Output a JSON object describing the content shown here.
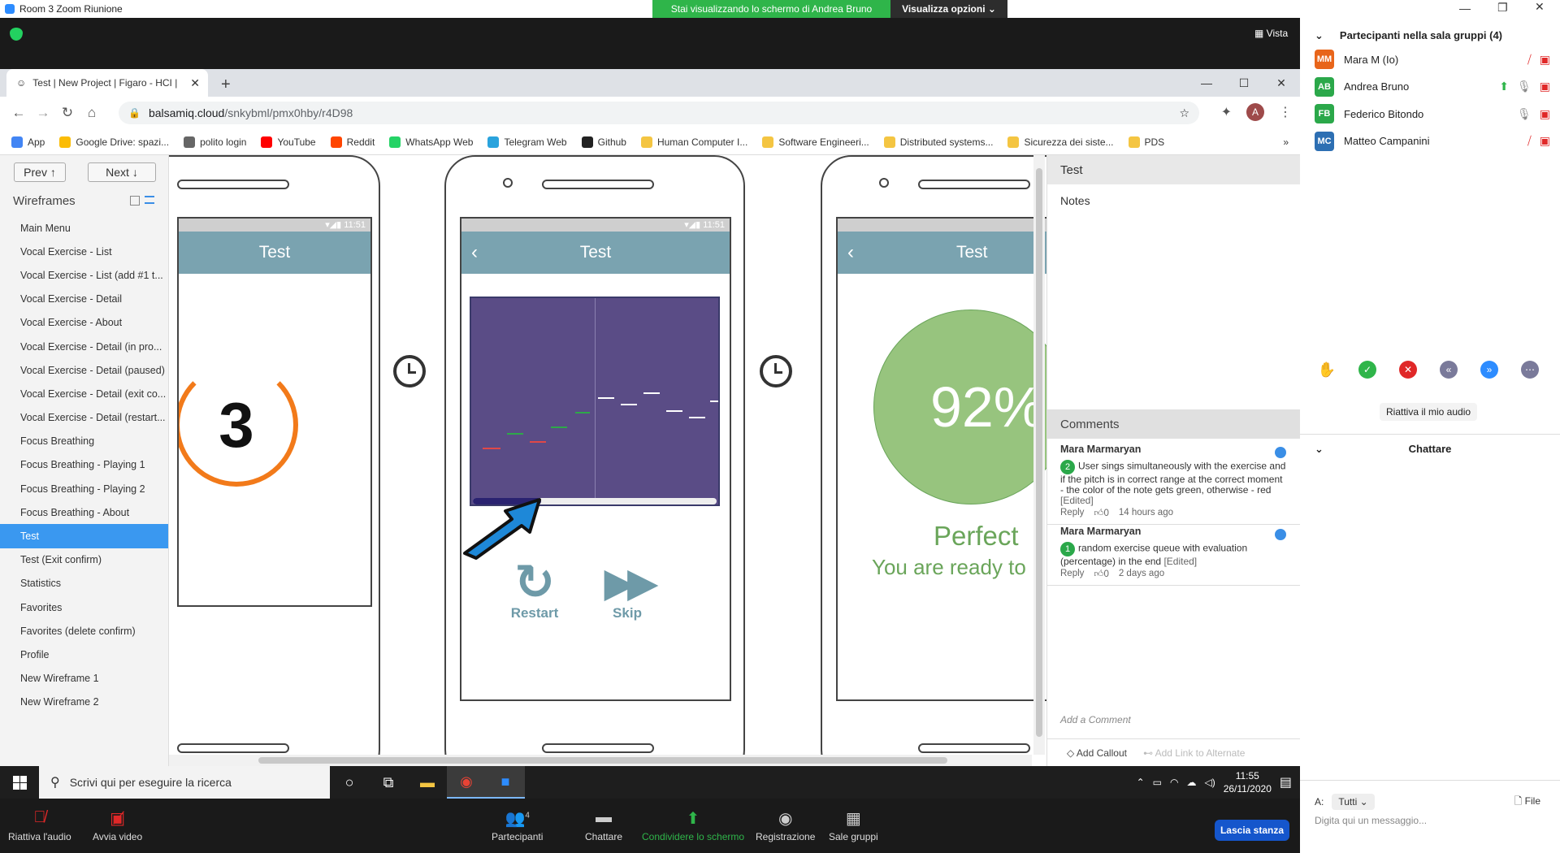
{
  "zoom": {
    "window_title": "Room 3   Zoom Riunione",
    "share_banner": "Stai visualizzando lo schermo di Andrea Bruno",
    "view_options": "Visualizza opzioni ⌄",
    "view_label": "Vista",
    "participants_header": "Partecipanti nella sala gruppi (4)",
    "participants": [
      {
        "initials": "MM",
        "name": "Mara M (Io)",
        "color": "#e8651a"
      },
      {
        "initials": "AB",
        "name": "Andrea Bruno",
        "color": "#2ba84a"
      },
      {
        "initials": "FB",
        "name": "Federico Bitondo",
        "color": "#2ba84a"
      },
      {
        "initials": "MC",
        "name": "Matteo Campanini",
        "color": "#2d6fb3"
      }
    ],
    "unmute_me": "Riattiva il mio audio",
    "chat_title": "Chattare",
    "chat_to_label": "A:",
    "chat_to_value": "Tutti ⌄",
    "chat_file": "File",
    "chat_placeholder": "Digita qui un messaggio...",
    "bottom": {
      "unmute": "Riattiva l'audio",
      "start_video": "Avvia video",
      "participants": "Partecipanti",
      "participants_count": "4",
      "chat": "Chattare",
      "share": "Condividere lo schermo",
      "record": "Registrazione",
      "breakout": "Sale gruppi",
      "leave": "Lascia stanza"
    }
  },
  "chrome": {
    "tab_title": "Test | New Project | Figaro - HCI |",
    "url_host": "balsamiq.cloud",
    "url_path": "/snkybml/pmx0hby/r4D98",
    "avatar": "A",
    "bookmarks": [
      {
        "label": "App",
        "color": "#4285f4"
      },
      {
        "label": "Google Drive: spazi...",
        "color": "#fbbc05"
      },
      {
        "label": "polito login",
        "color": "#666"
      },
      {
        "label": "YouTube",
        "color": "#ff0000"
      },
      {
        "label": "Reddit",
        "color": "#ff4500"
      },
      {
        "label": "WhatsApp Web",
        "color": "#25d366"
      },
      {
        "label": "Telegram Web",
        "color": "#2aa3dd"
      },
      {
        "label": "Github",
        "color": "#222"
      },
      {
        "label": "Human Computer I...",
        "color": "#f4c542"
      },
      {
        "label": "Software Engineeri...",
        "color": "#f4c542"
      },
      {
        "label": "Distributed systems...",
        "color": "#f4c542"
      },
      {
        "label": "Sicurezza dei siste...",
        "color": "#f4c542"
      },
      {
        "label": "PDS",
        "color": "#f4c542"
      }
    ]
  },
  "balsamiq": {
    "prev": "Prev ↑",
    "next": "Next ↓",
    "wireframes_title": "Wireframes",
    "wireframes": [
      "Main Menu",
      "Vocal Exercise - List",
      "Vocal Exercise - List (add #1 t...",
      "Vocal Exercise - Detail",
      "Vocal Exercise - About",
      "Vocal Exercise - Detail (in pro...",
      "Vocal Exercise - Detail (paused)",
      "Vocal Exercise - Detail (exit co...",
      "Vocal Exercise - Detail (restart...",
      "Focus Breathing",
      "Focus Breathing - Playing 1",
      "Focus Breathing - Playing 2",
      "Focus Breathing - About",
      "Test",
      "Test (Exit confirm)",
      "Statistics",
      "Favorites",
      "Favorites (delete confirm)",
      "Profile",
      "New Wireframe 1",
      "New Wireframe 2"
    ],
    "selected_index": 13,
    "phone_status_time": "11:51",
    "phone_title": "Test",
    "countdown": "3",
    "restart": "Restart",
    "skip": "Skip",
    "score": "92%",
    "perfect": "Perfect",
    "ready": "You are ready to",
    "panel_title": "Test",
    "notes": "Notes",
    "comments_title": "Comments",
    "comments": [
      {
        "author": "Mara Marmaryan",
        "num": "2",
        "text": "User sings simultaneously with the exercise and if the pitch is in correct range at the correct moment - the color of the note gets green, otherwise - red",
        "edited": "[Edited]",
        "reply": "Reply",
        "likes": "0",
        "time": "14 hours ago"
      },
      {
        "author": "Mara Marmaryan",
        "num": "1",
        "text": "random exercise queue with evaluation (percentage) in the end",
        "edited": "[Edited]",
        "reply": "Reply",
        "likes": "0",
        "time": "2 days ago"
      }
    ],
    "add_comment": "Add a Comment",
    "add_callout": "Add Callout",
    "add_link": "Add Link to Alternate"
  },
  "taskbar": {
    "search": "Scrivi qui per eseguire la ricerca",
    "time": "11:55",
    "date": "26/11/2020"
  }
}
